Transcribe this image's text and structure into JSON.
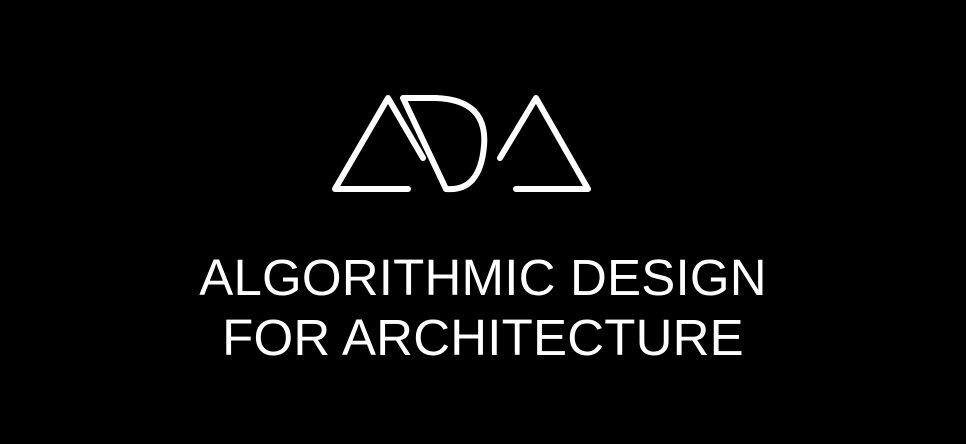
{
  "logo": {
    "name": "ADA",
    "icon": "ada-logo-mark",
    "stroke_color": "#ffffff"
  },
  "title": {
    "line1": "ALGORITHMIC DESIGN",
    "line2": "FOR ARCHITECTURE"
  },
  "colors": {
    "background": "#000000",
    "foreground": "#ffffff"
  }
}
